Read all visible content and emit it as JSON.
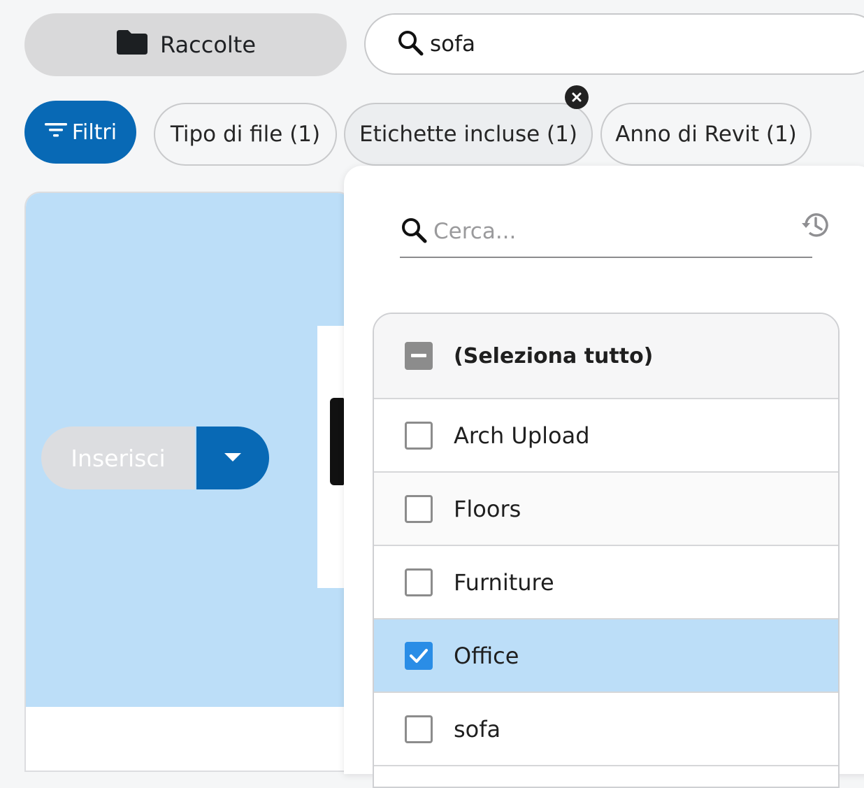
{
  "header": {
    "collections_label": "Raccolte",
    "search_value": "sofa"
  },
  "filters": {
    "filters_label": "Filtri",
    "chips": [
      {
        "label": "Tipo di file (1)"
      },
      {
        "label": "Etichette incluse (1)"
      },
      {
        "label": "Anno di Revit (1)"
      }
    ]
  },
  "card": {
    "insert_label": "Inserisci"
  },
  "dropdown": {
    "search_placeholder": "Cerca...",
    "select_all_label": "(Seleziona tutto)",
    "select_all_state": "indeterminate",
    "options": [
      {
        "label": "Arch Upload",
        "checked": false
      },
      {
        "label": "Floors",
        "checked": false
      },
      {
        "label": "Furniture",
        "checked": false
      },
      {
        "label": "Office",
        "checked": true
      },
      {
        "label": "sofa",
        "checked": false
      }
    ]
  },
  "colors": {
    "accent": "#0869b5",
    "selected_row": "#bcdef8",
    "checkbox_checked": "#2a8de6"
  }
}
